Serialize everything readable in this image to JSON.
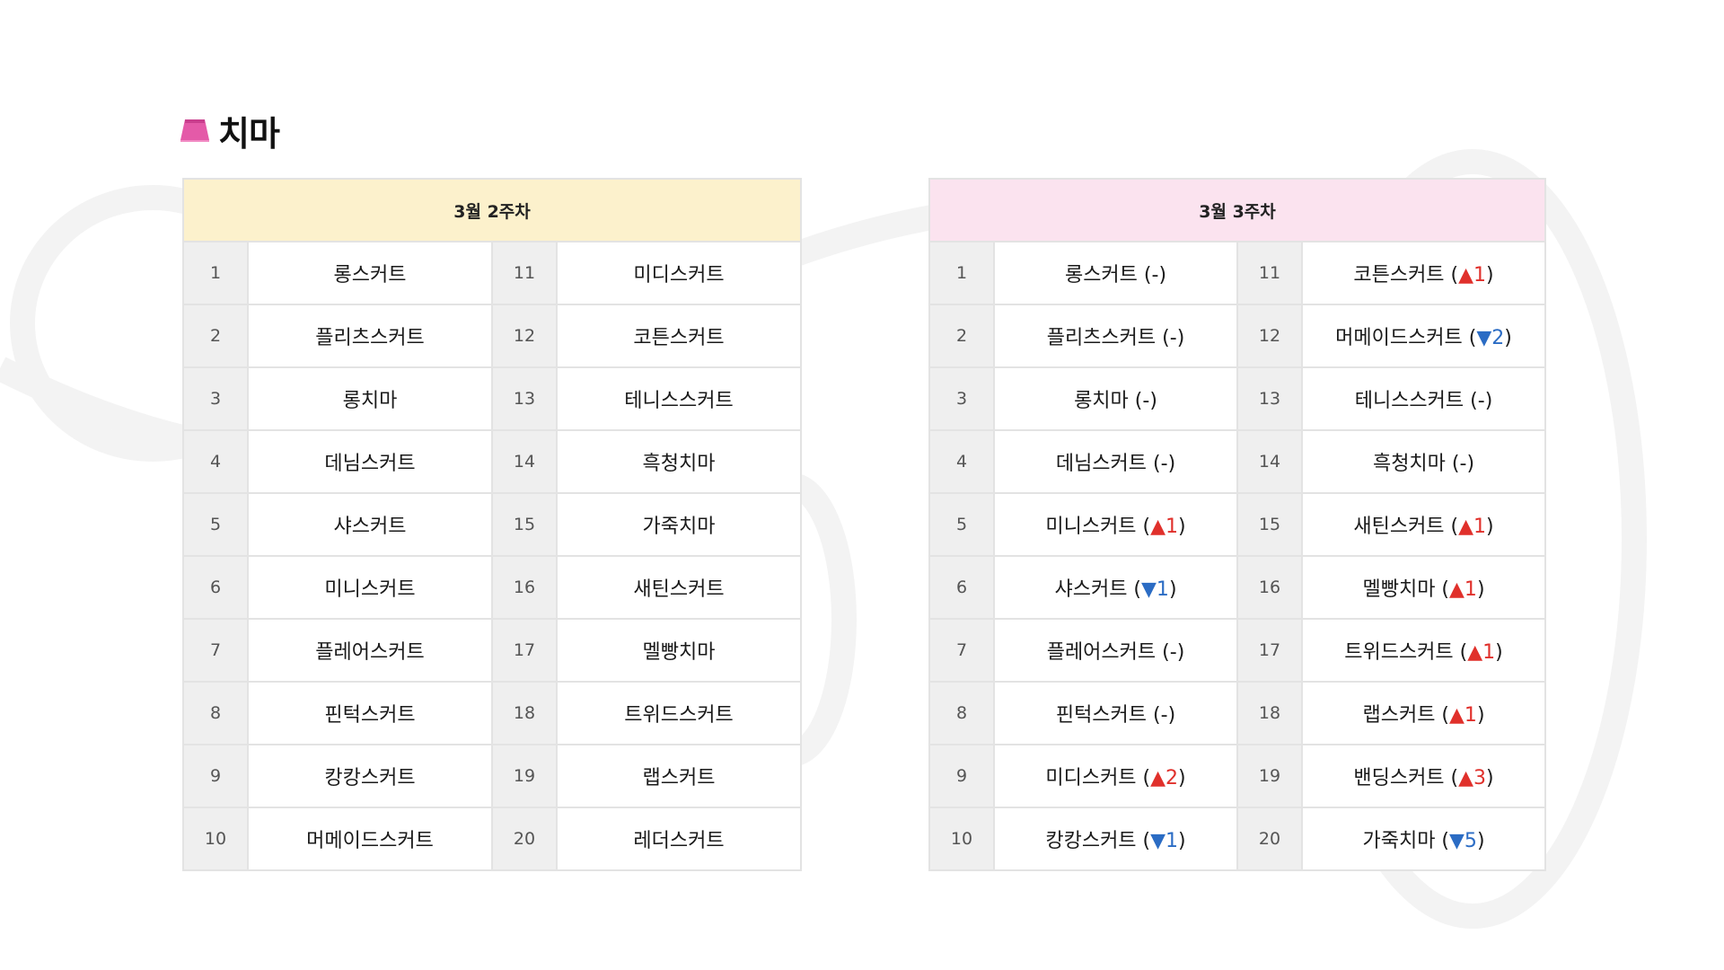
{
  "section": {
    "title": "치마",
    "icon": "skirt-icon",
    "icon_color": "#e45aa8"
  },
  "colors": {
    "week1_header_bg": "#fcf1cc",
    "week2_header_bg": "#fbe3ef",
    "up": "#e0302b",
    "down": "#2b6cc4"
  },
  "week1": {
    "header": "3월 2주차",
    "rows": [
      {
        "rank_a": "1",
        "name_a": "롱스커트",
        "rank_b": "11",
        "name_b": "미디스커트"
      },
      {
        "rank_a": "2",
        "name_a": "플리츠스커트",
        "rank_b": "12",
        "name_b": "코튼스커트"
      },
      {
        "rank_a": "3",
        "name_a": "롱치마",
        "rank_b": "13",
        "name_b": "테니스스커트"
      },
      {
        "rank_a": "4",
        "name_a": "데님스커트",
        "rank_b": "14",
        "name_b": "흑청치마"
      },
      {
        "rank_a": "5",
        "name_a": "샤스커트",
        "rank_b": "15",
        "name_b": "가죽치마"
      },
      {
        "rank_a": "6",
        "name_a": "미니스커트",
        "rank_b": "16",
        "name_b": "새틴스커트"
      },
      {
        "rank_a": "7",
        "name_a": "플레어스커트",
        "rank_b": "17",
        "name_b": "멜빵치마"
      },
      {
        "rank_a": "8",
        "name_a": "핀턱스커트",
        "rank_b": "18",
        "name_b": "트위드스커트"
      },
      {
        "rank_a": "9",
        "name_a": "캉캉스커트",
        "rank_b": "19",
        "name_b": "랩스커트"
      },
      {
        "rank_a": "10",
        "name_a": "머메이드스커트",
        "rank_b": "20",
        "name_b": "레더스커트"
      }
    ]
  },
  "week2": {
    "header": "3월 3주차",
    "rows": [
      {
        "rank_a": "1",
        "name_a": "롱스커트",
        "chg_a": "-",
        "dir_a": "none",
        "rank_b": "11",
        "name_b": "코튼스커트",
        "chg_b": "▲1",
        "dir_b": "up"
      },
      {
        "rank_a": "2",
        "name_a": "플리츠스커트",
        "chg_a": "-",
        "dir_a": "none",
        "rank_b": "12",
        "name_b": "머메이드스커트",
        "chg_b": "▼2",
        "dir_b": "down"
      },
      {
        "rank_a": "3",
        "name_a": "롱치마",
        "chg_a": "-",
        "dir_a": "none",
        "rank_b": "13",
        "name_b": "테니스스커트",
        "chg_b": "-",
        "dir_b": "none"
      },
      {
        "rank_a": "4",
        "name_a": "데님스커트",
        "chg_a": "-",
        "dir_a": "none",
        "rank_b": "14",
        "name_b": "흑청치마",
        "chg_b": "-",
        "dir_b": "none"
      },
      {
        "rank_a": "5",
        "name_a": "미니스커트",
        "chg_a": "▲1",
        "dir_a": "up",
        "rank_b": "15",
        "name_b": "새틴스커트",
        "chg_b": "▲1",
        "dir_b": "up"
      },
      {
        "rank_a": "6",
        "name_a": "샤스커트",
        "chg_a": "▼1",
        "dir_a": "down",
        "rank_b": "16",
        "name_b": "멜빵치마",
        "chg_b": "▲1",
        "dir_b": "up"
      },
      {
        "rank_a": "7",
        "name_a": "플레어스커트",
        "chg_a": "-",
        "dir_a": "none",
        "rank_b": "17",
        "name_b": "트위드스커트",
        "chg_b": "▲1",
        "dir_b": "up"
      },
      {
        "rank_a": "8",
        "name_a": "핀턱스커트",
        "chg_a": "-",
        "dir_a": "none",
        "rank_b": "18",
        "name_b": "랩스커트",
        "chg_b": "▲1",
        "dir_b": "up"
      },
      {
        "rank_a": "9",
        "name_a": "미디스커트",
        "chg_a": "▲2",
        "dir_a": "up",
        "rank_b": "19",
        "name_b": "밴딩스커트",
        "chg_b": "▲3",
        "dir_b": "up"
      },
      {
        "rank_a": "10",
        "name_a": "캉캉스커트",
        "chg_a": "▼1",
        "dir_a": "down",
        "rank_b": "20",
        "name_b": "가죽치마",
        "chg_b": "▼5",
        "dir_b": "down"
      }
    ]
  }
}
